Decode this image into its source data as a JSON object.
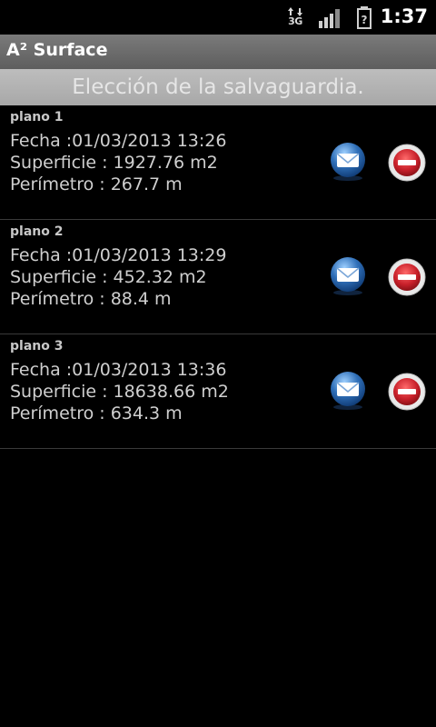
{
  "status_bar": {
    "time": "1:37",
    "network": "3G",
    "network_icon": "data-arrows-icon",
    "signal_icon": "signal-bars-icon",
    "battery_icon": "battery-unknown-icon"
  },
  "app": {
    "title": "A² Surface",
    "subtitle": "Elección de la salvaguardia."
  },
  "plans": [
    {
      "name": "plano 1",
      "fecha": "Fecha :01/03/2013 13:26",
      "superficie": "Superficie : 1927.76 m2",
      "perimetro": "Perímetro : 267.7 m"
    },
    {
      "name": "plano 2",
      "fecha": "Fecha :01/03/2013 13:29",
      "superficie": "Superficie : 452.32 m2",
      "perimetro": "Perímetro : 88.4 m"
    },
    {
      "name": "plano 3",
      "fecha": "Fecha :01/03/2013 13:36",
      "superficie": "Superficie : 18638.66 m2",
      "perimetro": "Perímetro : 634.3 m"
    }
  ],
  "colors": {
    "mail_button": "#2f6fb8",
    "delete_button": "#c8202a"
  }
}
